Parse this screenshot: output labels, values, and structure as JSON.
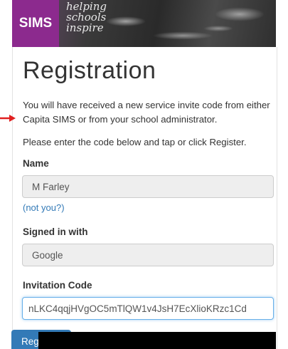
{
  "header": {
    "logo_text": "SIMS",
    "tagline": [
      "helping",
      "schools",
      "inspire"
    ],
    "brand_color": "#8c2a8e"
  },
  "page": {
    "title": "Registration",
    "intro": "You will have received a new service invite code from either Capita SIMS or from your school administrator.",
    "instruction": "Please enter the code below and tap or click Register.",
    "arrow_color": "#e02020"
  },
  "form": {
    "name_label": "Name",
    "name_value": "M Farley",
    "not_you_link": "(not you?)",
    "signed_in_label": "Signed in with",
    "signed_in_value": "Google",
    "invitation_label": "Invitation Code",
    "invitation_value": "nLKC4qqjHVgOC5mTlQW1v4JsH7EcXlioKRzc1Cd",
    "register_label": "Reg",
    "accent_color": "#337ab7"
  }
}
